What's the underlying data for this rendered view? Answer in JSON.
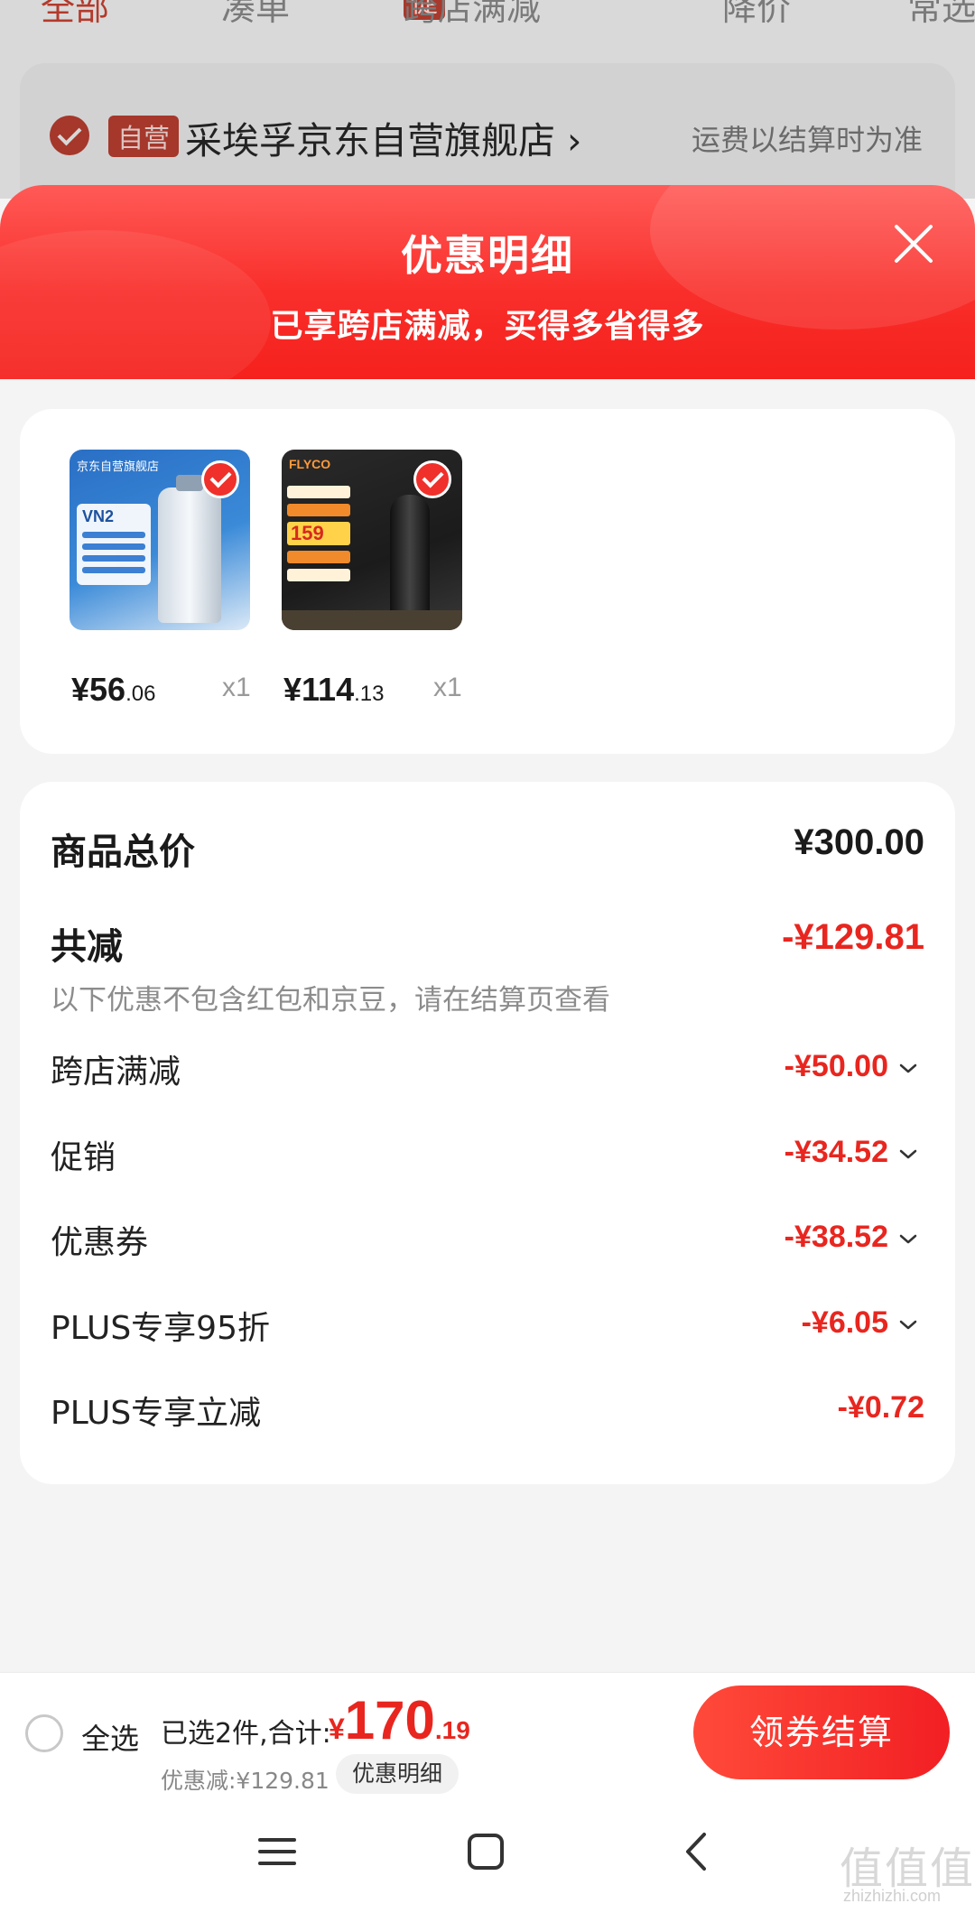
{
  "background_page": {
    "tabs": [
      "全部",
      "凑单",
      "跨店满减",
      "降价",
      "常选"
    ],
    "tab_tag": "促",
    "store_tag": "自营",
    "store_name": "采埃孚京东自营旗舰店 ›",
    "shipping_note": "运费以结算时为准"
  },
  "sheet": {
    "title": "优惠明细",
    "subtitle": "已享跨店满减，买得多省得多"
  },
  "products": [
    {
      "brand": "京东自营旗舰店",
      "label": "VN2",
      "price_int": "¥56",
      "price_dec": ".06",
      "qty": "x1"
    },
    {
      "brand": "FLYCO",
      "promo_price": "159",
      "price_int": "¥114",
      "price_dec": ".13",
      "qty": "x1"
    }
  ],
  "summary": {
    "total_label": "商品总价",
    "total_value": "¥300.00",
    "reduce_label": "共减",
    "reduce_value": "-¥129.81",
    "note": "以下优惠不包含红包和京豆，请在结算页查看",
    "rows": [
      {
        "label": "跨店满减",
        "value": "-¥50.00"
      },
      {
        "label": "促销",
        "value": "-¥34.52"
      },
      {
        "label": "优惠券",
        "value": "-¥38.52"
      },
      {
        "label": "PLUS专享95折",
        "value": "-¥6.05"
      },
      {
        "label": "PLUS专享立减",
        "value": "-¥0.72"
      }
    ]
  },
  "bottom_bar": {
    "select_all": "全选",
    "selected_summary": "已选2件,合计:",
    "currency": "¥",
    "total_int": "170",
    "total_dec": ".19",
    "discount_text": "优惠减:¥129.81",
    "discount_detail_button": "优惠明细",
    "checkout_button": "领券结算"
  },
  "watermark": {
    "glyphs": "值值值",
    "url": "zhizhizhi.com"
  },
  "colors": {
    "accent_red": "#e8261f",
    "header_red": "#f92e2a",
    "background": "#f4f4f4"
  }
}
